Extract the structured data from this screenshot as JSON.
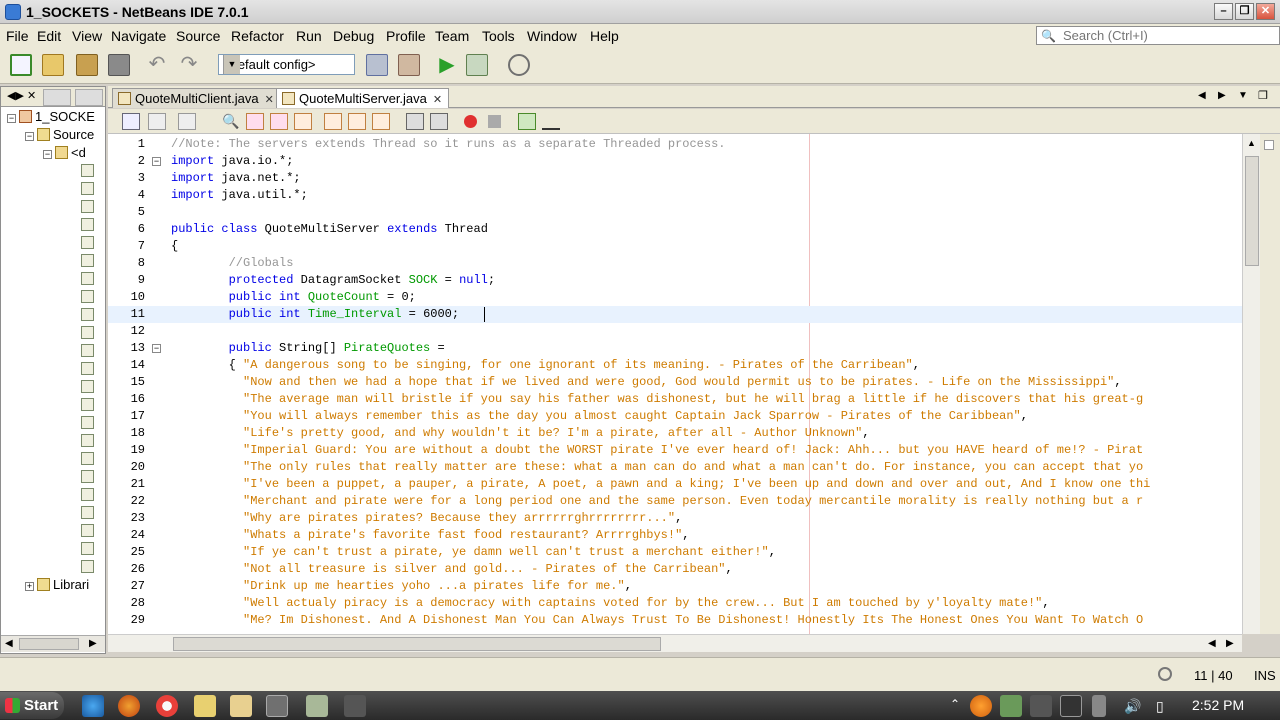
{
  "window": {
    "title": "1_SOCKETS - NetBeans IDE 7.0.1"
  },
  "menu": [
    "File",
    "Edit",
    "View",
    "Navigate",
    "Source",
    "Refactor",
    "Run",
    "Debug",
    "Profile",
    "Team",
    "Tools",
    "Window",
    "Help"
  ],
  "search": {
    "placeholder": "Search (Ctrl+I)"
  },
  "toolbar": {
    "config": "<default config>"
  },
  "project_tree": {
    "root": "1_SOCKE",
    "source": "Source",
    "package": "<d",
    "libraries": "Librari"
  },
  "editor_tabs": [
    {
      "label": "QuoteMultiClient.java",
      "active": false
    },
    {
      "label": "QuoteMultiServer.java",
      "active": true
    }
  ],
  "code_lines": [
    {
      "n": "1",
      "t": "//Note: The servers extends Thread so it runs as a separate Threaded process."
    },
    {
      "n": "2",
      "t": "import java.io.*;"
    },
    {
      "n": "3",
      "t": "import java.net.*;"
    },
    {
      "n": "4",
      "t": "import java.util.*;"
    },
    {
      "n": "5",
      "t": ""
    },
    {
      "n": "6",
      "t": "public class QuoteMultiServer extends Thread"
    },
    {
      "n": "7",
      "t": "{"
    },
    {
      "n": "8",
      "t": "        //Globals"
    },
    {
      "n": "9",
      "t": "        protected DatagramSocket SOCK = null;"
    },
    {
      "n": "10",
      "t": "        public int QuoteCount = 0;"
    },
    {
      "n": "11",
      "t": "        public int Time_Interval = 6000;"
    },
    {
      "n": "12",
      "t": ""
    },
    {
      "n": "13",
      "t": "        public String[] PirateQuotes ="
    },
    {
      "n": "14",
      "t": "        { \"A dangerous song to be singing, for one ignorant of its meaning. - Pirates of the Carribean\","
    },
    {
      "n": "15",
      "t": "          \"Now and then we had a hope that if we lived and were good, God would permit us to be pirates. - Life on the Mississippi\","
    },
    {
      "n": "16",
      "t": "          \"The average man will bristle if you say his father was dishonest, but he will brag a little if he discovers that his great-g"
    },
    {
      "n": "17",
      "t": "          \"You will always remember this as the day you almost caught Captain Jack Sparrow - Pirates of the Caribbean\","
    },
    {
      "n": "18",
      "t": "          \"Life's pretty good, and why wouldn't it be? I'm a pirate, after all - Author Unknown\","
    },
    {
      "n": "19",
      "t": "          \"Imperial Guard: You are without a doubt the WORST pirate I've ever heard of! Jack: Ahh... but you HAVE heard of me!? - Pirat"
    },
    {
      "n": "20",
      "t": "          \"The only rules that really matter are these: what a man can do and what a man can't do. For instance, you can accept that yo"
    },
    {
      "n": "21",
      "t": "          \"I've been a puppet, a pauper, a pirate, A poet, a pawn and a king; I've been up and down and over and out, And I know one thi"
    },
    {
      "n": "22",
      "t": "          \"Merchant and pirate were for a long period one and the same person. Even today mercantile morality is really nothing but a r"
    },
    {
      "n": "23",
      "t": "          \"Why are pirates pirates? Because they arrrrrrghrrrrrrrr...\","
    },
    {
      "n": "24",
      "t": "          \"Whats a pirate's favorite fast food restaurant? Arrrrghbys!\","
    },
    {
      "n": "25",
      "t": "          \"If ye can't trust a pirate, ye damn well can't trust a merchant either!\","
    },
    {
      "n": "26",
      "t": "          \"Not all treasure is silver and gold... - Pirates of the Carribean\","
    },
    {
      "n": "27",
      "t": "          \"Drink up me hearties yoho ...a pirates life for me.\","
    },
    {
      "n": "28",
      "t": "          \"Well actualy piracy is a democracy with captains voted for by the crew... But I am touched by y'loyalty mate!\","
    },
    {
      "n": "29",
      "t": "          \"Me? Im Dishonest. And A Dishonest Man You Can Always Trust To Be Dishonest! Honestly Its The Honest Ones You Want To Watch O"
    }
  ],
  "status": {
    "position": "11 | 40",
    "mode": "INS"
  },
  "taskbar": {
    "start": "Start",
    "clock": "2:52 PM"
  }
}
